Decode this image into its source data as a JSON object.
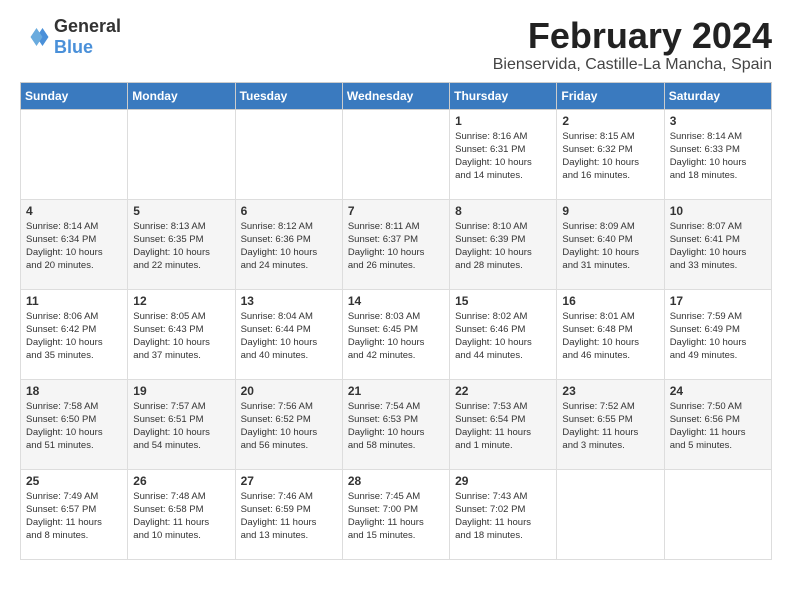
{
  "logo": {
    "general": "General",
    "blue": "Blue"
  },
  "title": "February 2024",
  "subtitle": "Bienservida, Castille-La Mancha, Spain",
  "days_header": [
    "Sunday",
    "Monday",
    "Tuesday",
    "Wednesday",
    "Thursday",
    "Friday",
    "Saturday"
  ],
  "weeks": [
    [
      {
        "day": "",
        "info": ""
      },
      {
        "day": "",
        "info": ""
      },
      {
        "day": "",
        "info": ""
      },
      {
        "day": "",
        "info": ""
      },
      {
        "day": "1",
        "info": "Sunrise: 8:16 AM\nSunset: 6:31 PM\nDaylight: 10 hours\nand 14 minutes."
      },
      {
        "day": "2",
        "info": "Sunrise: 8:15 AM\nSunset: 6:32 PM\nDaylight: 10 hours\nand 16 minutes."
      },
      {
        "day": "3",
        "info": "Sunrise: 8:14 AM\nSunset: 6:33 PM\nDaylight: 10 hours\nand 18 minutes."
      }
    ],
    [
      {
        "day": "4",
        "info": "Sunrise: 8:14 AM\nSunset: 6:34 PM\nDaylight: 10 hours\nand 20 minutes."
      },
      {
        "day": "5",
        "info": "Sunrise: 8:13 AM\nSunset: 6:35 PM\nDaylight: 10 hours\nand 22 minutes."
      },
      {
        "day": "6",
        "info": "Sunrise: 8:12 AM\nSunset: 6:36 PM\nDaylight: 10 hours\nand 24 minutes."
      },
      {
        "day": "7",
        "info": "Sunrise: 8:11 AM\nSunset: 6:37 PM\nDaylight: 10 hours\nand 26 minutes."
      },
      {
        "day": "8",
        "info": "Sunrise: 8:10 AM\nSunset: 6:39 PM\nDaylight: 10 hours\nand 28 minutes."
      },
      {
        "day": "9",
        "info": "Sunrise: 8:09 AM\nSunset: 6:40 PM\nDaylight: 10 hours\nand 31 minutes."
      },
      {
        "day": "10",
        "info": "Sunrise: 8:07 AM\nSunset: 6:41 PM\nDaylight: 10 hours\nand 33 minutes."
      }
    ],
    [
      {
        "day": "11",
        "info": "Sunrise: 8:06 AM\nSunset: 6:42 PM\nDaylight: 10 hours\nand 35 minutes."
      },
      {
        "day": "12",
        "info": "Sunrise: 8:05 AM\nSunset: 6:43 PM\nDaylight: 10 hours\nand 37 minutes."
      },
      {
        "day": "13",
        "info": "Sunrise: 8:04 AM\nSunset: 6:44 PM\nDaylight: 10 hours\nand 40 minutes."
      },
      {
        "day": "14",
        "info": "Sunrise: 8:03 AM\nSunset: 6:45 PM\nDaylight: 10 hours\nand 42 minutes."
      },
      {
        "day": "15",
        "info": "Sunrise: 8:02 AM\nSunset: 6:46 PM\nDaylight: 10 hours\nand 44 minutes."
      },
      {
        "day": "16",
        "info": "Sunrise: 8:01 AM\nSunset: 6:48 PM\nDaylight: 10 hours\nand 46 minutes."
      },
      {
        "day": "17",
        "info": "Sunrise: 7:59 AM\nSunset: 6:49 PM\nDaylight: 10 hours\nand 49 minutes."
      }
    ],
    [
      {
        "day": "18",
        "info": "Sunrise: 7:58 AM\nSunset: 6:50 PM\nDaylight: 10 hours\nand 51 minutes."
      },
      {
        "day": "19",
        "info": "Sunrise: 7:57 AM\nSunset: 6:51 PM\nDaylight: 10 hours\nand 54 minutes."
      },
      {
        "day": "20",
        "info": "Sunrise: 7:56 AM\nSunset: 6:52 PM\nDaylight: 10 hours\nand 56 minutes."
      },
      {
        "day": "21",
        "info": "Sunrise: 7:54 AM\nSunset: 6:53 PM\nDaylight: 10 hours\nand 58 minutes."
      },
      {
        "day": "22",
        "info": "Sunrise: 7:53 AM\nSunset: 6:54 PM\nDaylight: 11 hours\nand 1 minute."
      },
      {
        "day": "23",
        "info": "Sunrise: 7:52 AM\nSunset: 6:55 PM\nDaylight: 11 hours\nand 3 minutes."
      },
      {
        "day": "24",
        "info": "Sunrise: 7:50 AM\nSunset: 6:56 PM\nDaylight: 11 hours\nand 5 minutes."
      }
    ],
    [
      {
        "day": "25",
        "info": "Sunrise: 7:49 AM\nSunset: 6:57 PM\nDaylight: 11 hours\nand 8 minutes."
      },
      {
        "day": "26",
        "info": "Sunrise: 7:48 AM\nSunset: 6:58 PM\nDaylight: 11 hours\nand 10 minutes."
      },
      {
        "day": "27",
        "info": "Sunrise: 7:46 AM\nSunset: 6:59 PM\nDaylight: 11 hours\nand 13 minutes."
      },
      {
        "day": "28",
        "info": "Sunrise: 7:45 AM\nSunset: 7:00 PM\nDaylight: 11 hours\nand 15 minutes."
      },
      {
        "day": "29",
        "info": "Sunrise: 7:43 AM\nSunset: 7:02 PM\nDaylight: 11 hours\nand 18 minutes."
      },
      {
        "day": "",
        "info": ""
      },
      {
        "day": "",
        "info": ""
      }
    ]
  ]
}
